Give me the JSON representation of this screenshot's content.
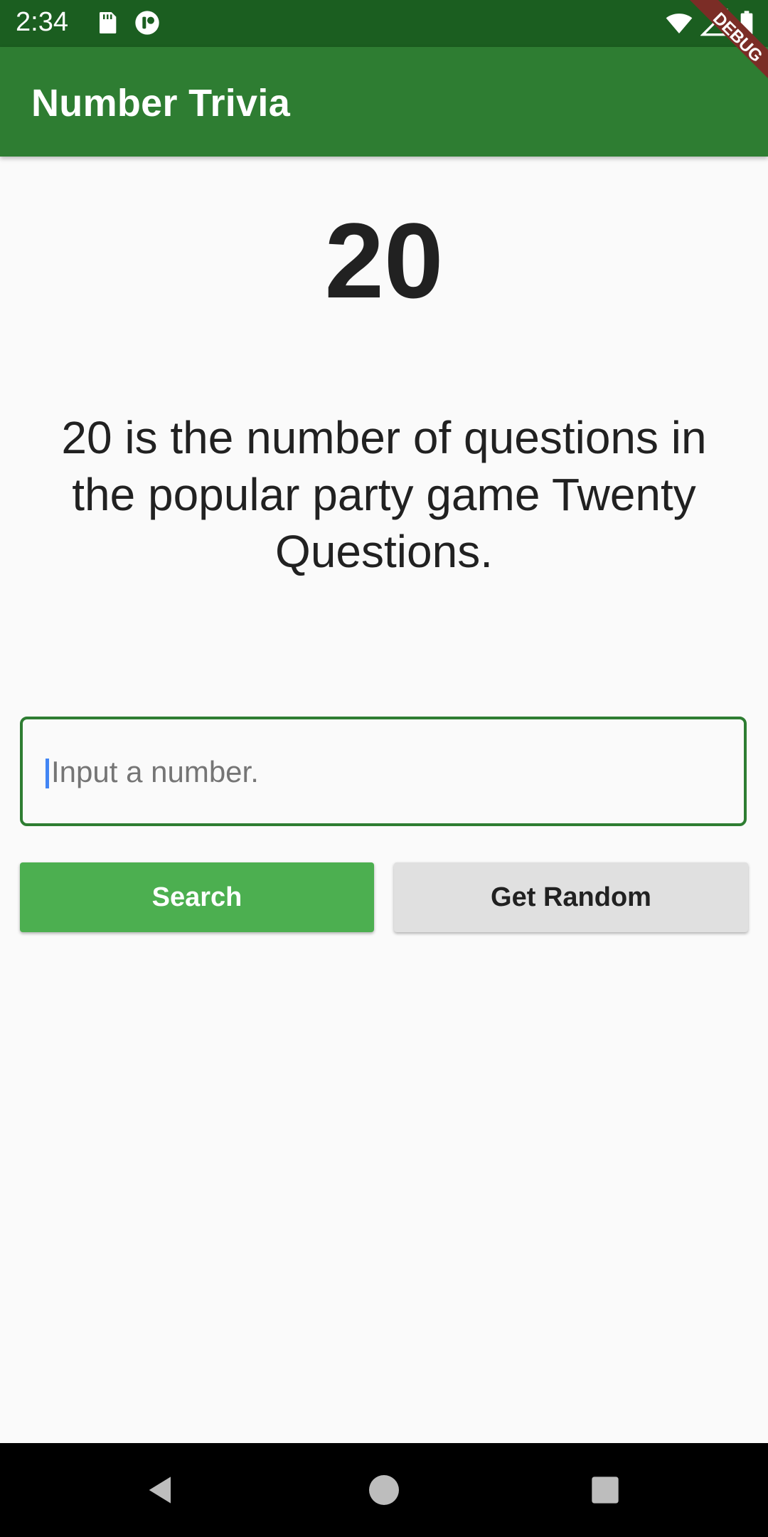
{
  "status_bar": {
    "time": "2:34",
    "left_icons": [
      "sd-card-icon",
      "app-notification-icon"
    ],
    "right_icons": [
      "wifi-icon",
      "cell-signal-icon",
      "battery-icon"
    ]
  },
  "debug_banner": {
    "label": "DEBUG",
    "color": "#7b2d26"
  },
  "app_bar": {
    "title": "Number Trivia",
    "color": "#2e7d32"
  },
  "trivia": {
    "number": "20",
    "text": "20 is the number of questions in the popular party game Twenty Questions."
  },
  "input": {
    "placeholder": "Input a number.",
    "value": ""
  },
  "buttons": {
    "search_label": "Search",
    "random_label": "Get Random",
    "search_color": "#4caf50",
    "random_color": "#e0e0e0"
  },
  "nav_bar": {
    "icons": [
      "back-icon",
      "home-icon",
      "recents-icon"
    ]
  }
}
